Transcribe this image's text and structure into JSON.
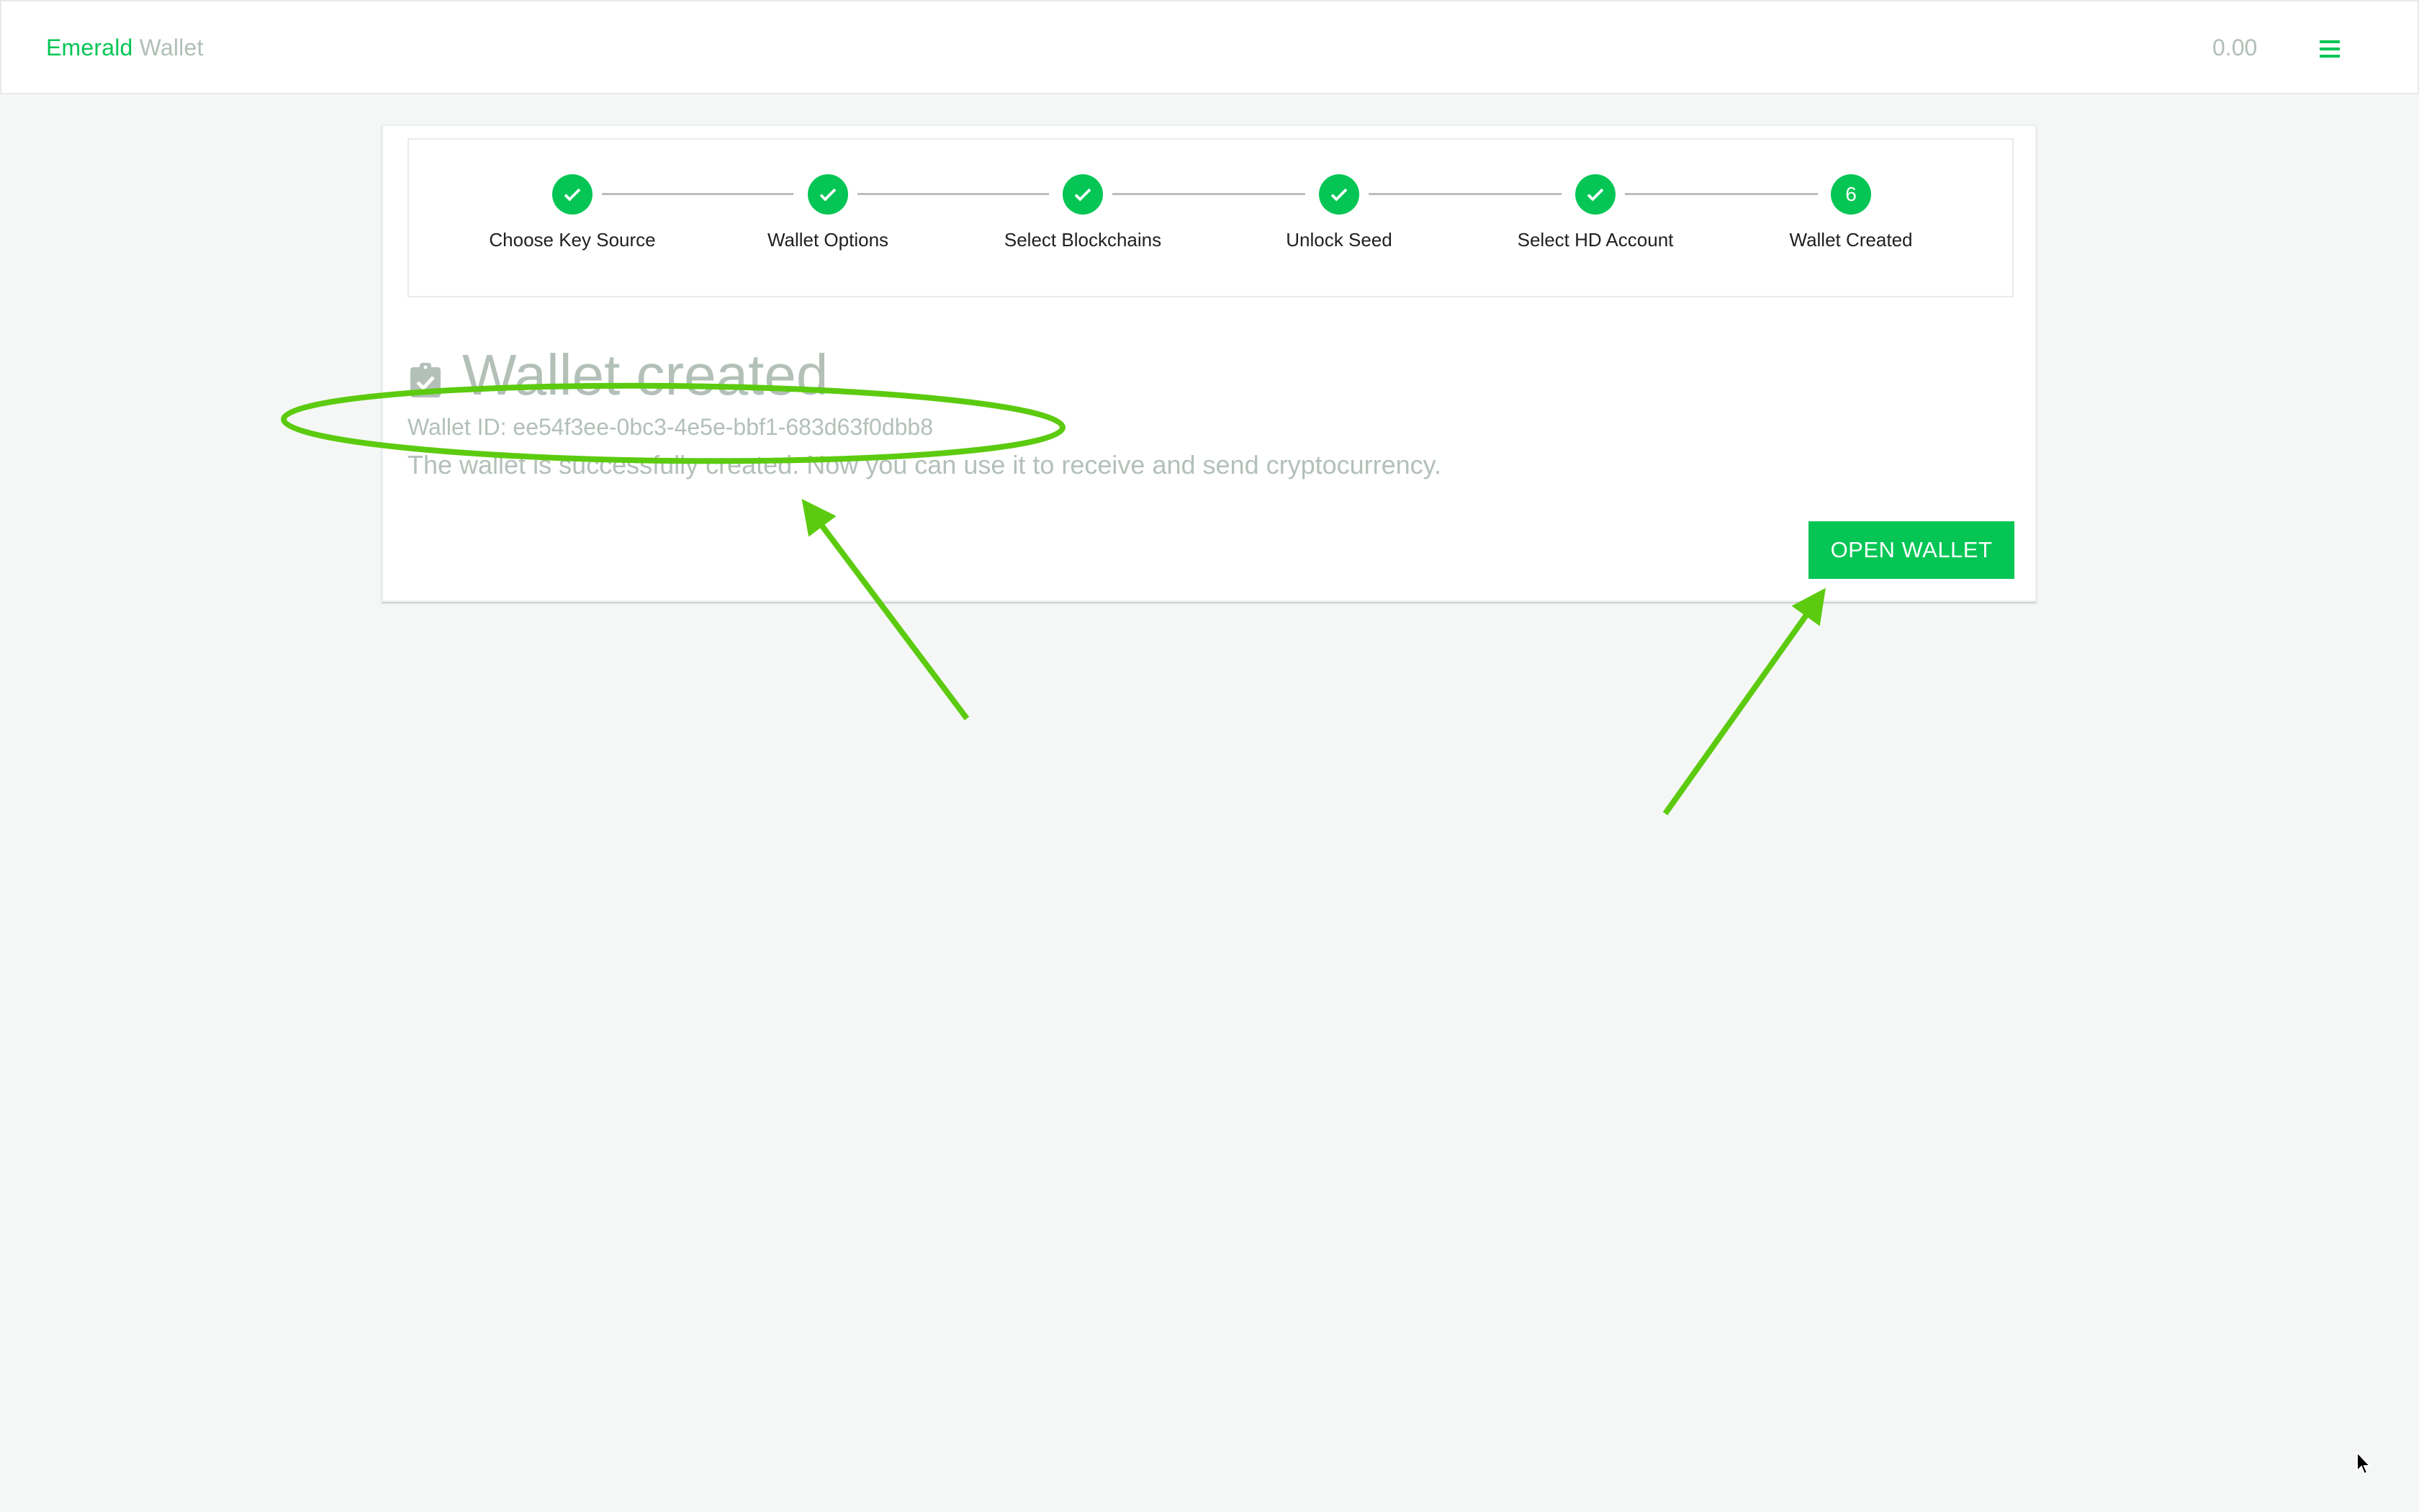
{
  "header": {
    "brand_primary": "Emerald",
    "brand_secondary": "Wallet",
    "balance": "0.00",
    "menu_icon": "hamburger-menu-icon"
  },
  "stepper": {
    "steps": [
      {
        "label": "Choose Key Source",
        "status": "completed",
        "icon": "check-icon"
      },
      {
        "label": "Wallet Options",
        "status": "completed",
        "icon": "check-icon"
      },
      {
        "label": "Select Blockchains",
        "status": "completed",
        "icon": "check-icon"
      },
      {
        "label": "Unlock Seed",
        "status": "completed",
        "icon": "check-icon"
      },
      {
        "label": "Select HD Account",
        "status": "completed",
        "icon": "check-icon"
      },
      {
        "label": "Wallet Created",
        "status": "active",
        "number": "6"
      }
    ]
  },
  "result": {
    "icon": "clipboard-check-icon",
    "title": "Wallet created",
    "wallet_id_label": "Wallet ID: ee54f3ee-0bc3-4e5e-bbf1-683d63f0dbb8",
    "description": "The wallet is successfully created. Now you can use it to receive and send cryptocurrency.",
    "open_button_label": "OPEN WALLET"
  },
  "colors": {
    "accent": "#05c655",
    "muted_text": "#b3c0b8",
    "annotation": "#5ccb0f",
    "background": "#f5f7f6"
  }
}
